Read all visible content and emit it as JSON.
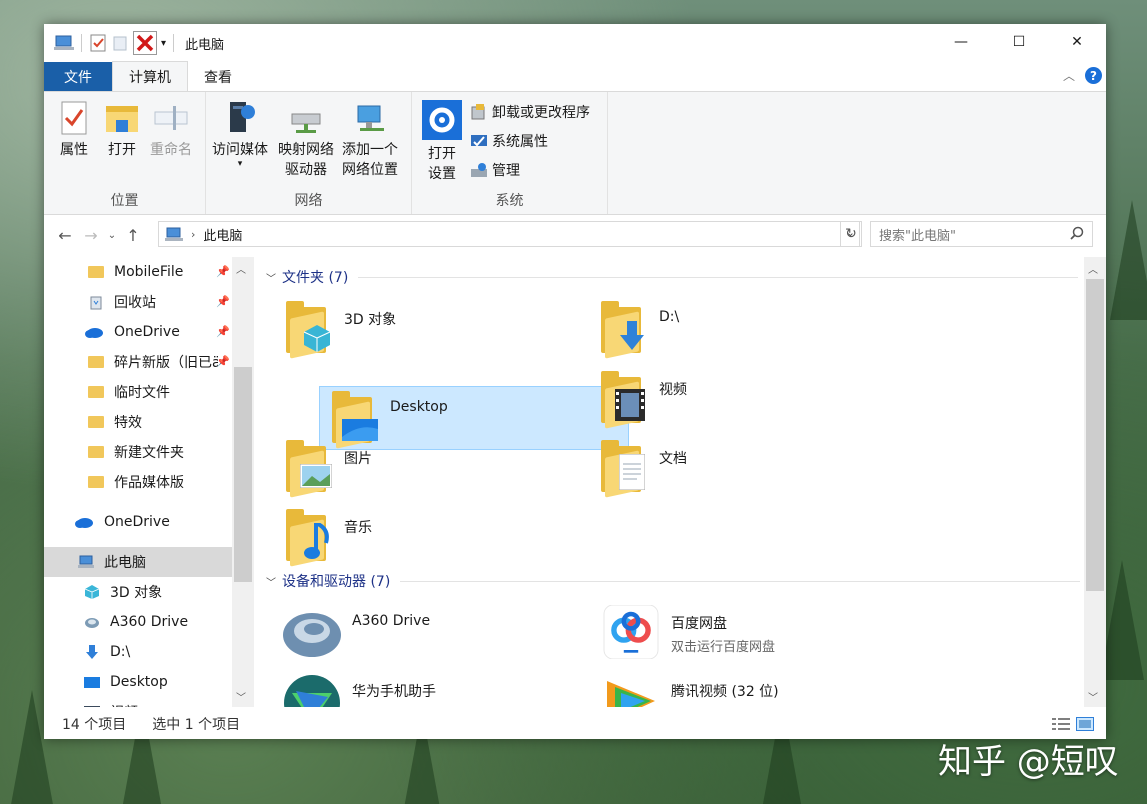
{
  "window": {
    "title": "此电脑",
    "controls": {
      "minimize": "—",
      "maximize": "☐",
      "close": "✕"
    }
  },
  "ribbon": {
    "tabs": [
      {
        "label": "文件"
      },
      {
        "label": "计算机"
      },
      {
        "label": "查看"
      }
    ],
    "help": "?",
    "groups": {
      "location": {
        "label": "位置",
        "properties": "属性",
        "open": "打开",
        "rename": "重命名"
      },
      "network": {
        "label": "网络",
        "access_media": "访问媒体",
        "map_drive_1": "映射网络",
        "map_drive_2": "驱动器",
        "add_location_1": "添加一个",
        "add_location_2": "网络位置"
      },
      "system": {
        "label": "系统",
        "open_settings_1": "打开",
        "open_settings_2": "设置",
        "uninstall": "卸载或更改程序",
        "system_properties": "系统属性",
        "manage": "管理"
      }
    }
  },
  "address": {
    "path": "此电脑",
    "search_placeholder": "搜索\"此电脑\""
  },
  "nav": {
    "items": [
      {
        "label": "MobileFile",
        "pinned": true,
        "icon": "folder-icon"
      },
      {
        "label": "回收站",
        "pinned": true,
        "icon": "recycle-bin-icon"
      },
      {
        "label": "OneDrive",
        "pinned": true,
        "icon": "cloud-icon"
      },
      {
        "label": "碎片新版（旧已ä",
        "pinned": true,
        "icon": "folder-icon"
      },
      {
        "label": "临时文件",
        "pinned": false,
        "icon": "folder-icon"
      },
      {
        "label": "特效",
        "pinned": false,
        "icon": "folder-icon"
      },
      {
        "label": "新建文件夹",
        "pinned": false,
        "icon": "folder-icon"
      },
      {
        "label": "作品媒体版",
        "pinned": false,
        "icon": "folder-icon"
      },
      {
        "label": "OneDrive",
        "pinned": false,
        "icon": "cloud-icon"
      },
      {
        "label": "此电脑",
        "pinned": false,
        "icon": "computer-icon"
      },
      {
        "label": "3D 对象",
        "pinned": false,
        "icon": "cube-icon"
      },
      {
        "label": "A360 Drive",
        "pinned": false,
        "icon": "a360-icon"
      },
      {
        "label": "D:\\",
        "pinned": false,
        "icon": "download-arrow-icon"
      },
      {
        "label": "Desktop",
        "pinned": false,
        "icon": "desktop-icon"
      },
      {
        "label": "视频",
        "pinned": false,
        "icon": "video-icon"
      }
    ]
  },
  "content": {
    "folders_header": "文件夹 (7)",
    "folders": [
      {
        "name": "3D 对象"
      },
      {
        "name": "D:\\"
      },
      {
        "name": "Desktop"
      },
      {
        "name": "视频"
      },
      {
        "name": "图片"
      },
      {
        "name": "文档"
      },
      {
        "name": "音乐"
      }
    ],
    "devices_header": "设备和驱动器 (7)",
    "devices": [
      {
        "name": "A360 Drive",
        "sub": ""
      },
      {
        "name": "百度网盘",
        "sub": "双击运行百度网盘"
      },
      {
        "name": "华为手机助手",
        "sub": ""
      },
      {
        "name": "腾讯视频 (32 位)",
        "sub": ""
      }
    ]
  },
  "status": {
    "count": "14 个项目",
    "selected": "选中 1 个项目"
  },
  "watermark": "知乎 @短叹",
  "colors": {
    "accent": "#1a5fa8",
    "selection": "#cce8ff",
    "folder": "#f8d775"
  }
}
